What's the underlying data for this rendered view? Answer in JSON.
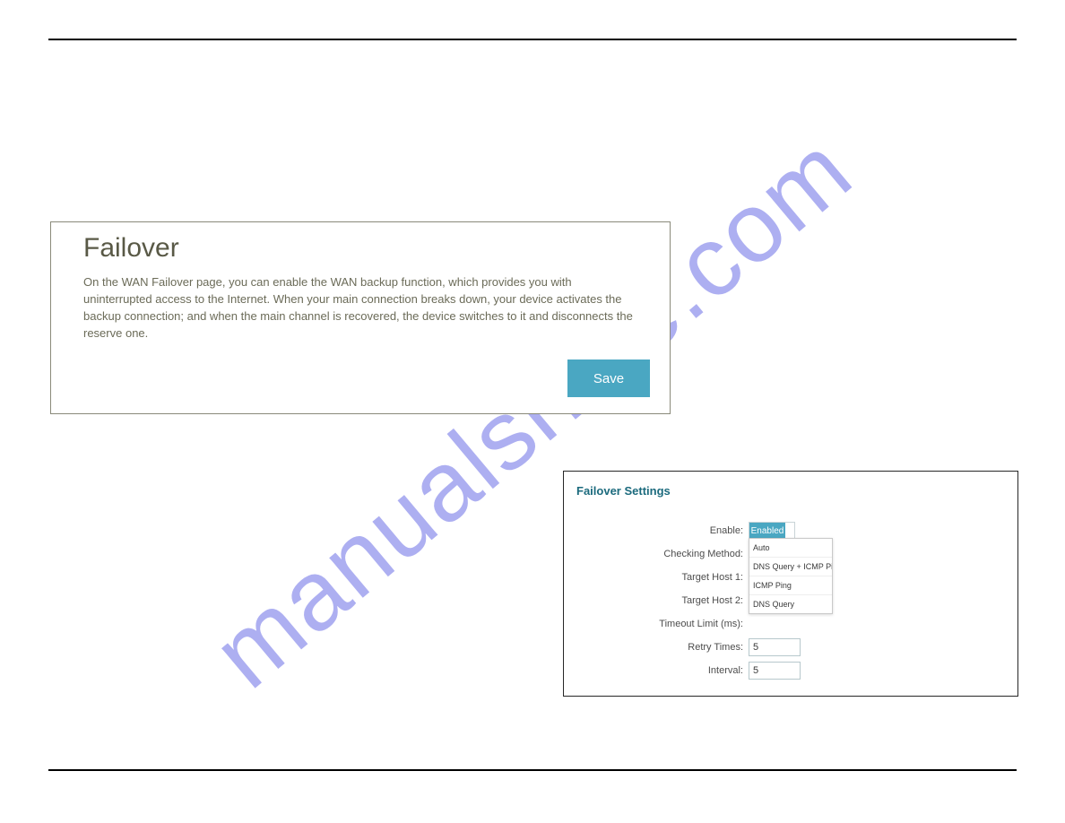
{
  "watermark": "manualshive.com",
  "failover_box": {
    "title": "Failover",
    "description": "On the WAN Failover page, you can enable the WAN backup function, which provides you with uninterrupted access to the Internet. When your main connection breaks down, your device activates the backup connection; and when the main channel is recovered, the device switches to it and disconnects the reserve one.",
    "save_label": "Save"
  },
  "settings_box": {
    "title": "Failover Settings",
    "labels": {
      "enable": "Enable:",
      "method": "Checking Method:",
      "host1": "Target Host 1:",
      "host2": "Target Host 2:",
      "timeout": "Timeout Limit (ms):",
      "retry": "Retry Times:",
      "interval": "Interval:"
    },
    "enable_state": "Enabled",
    "method_value": "DNS Query + ICMP…",
    "retry_value": "5",
    "interval_value": "5",
    "dropdown": [
      "Auto",
      "DNS Query + ICMP Ping",
      "ICMP Ping",
      "DNS Query"
    ]
  }
}
